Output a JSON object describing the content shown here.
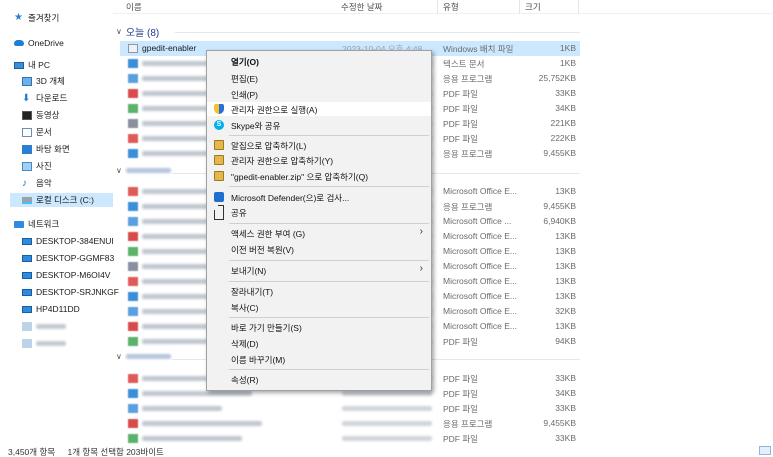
{
  "columns": {
    "name": "이름",
    "date": "수정한 날짜",
    "type": "유형",
    "size": "크기"
  },
  "sidebar": {
    "quick_access": "즐겨찾기",
    "onedrive": "OneDrive",
    "this_pc": "내 PC",
    "items": [
      {
        "label": "3D 개체",
        "icon": "cube-icon"
      },
      {
        "label": "다운로드",
        "icon": "download-icon"
      },
      {
        "label": "동영상",
        "icon": "video-icon"
      },
      {
        "label": "문서",
        "icon": "document-icon"
      },
      {
        "label": "바탕 화면",
        "icon": "desktop-icon"
      },
      {
        "label": "사진",
        "icon": "pictures-icon"
      },
      {
        "label": "음악",
        "icon": "music-icon"
      },
      {
        "label": "로컬 디스크 (C:)",
        "icon": "disk-icon"
      }
    ],
    "network": "네트워크",
    "computers": [
      "DESKTOP-384ENUI",
      "DESKTOP-GGMF83",
      "DESKTOP-M6OI4V",
      "DESKTOP-SRJNKGF",
      "HP4D11DD"
    ]
  },
  "group_today": {
    "label": "오늘 (8)"
  },
  "rows_today": [
    {
      "name": "gpedit-enabler",
      "date": "2023-10-04 오후 4:48",
      "type": "Windows 배치 파일",
      "size": "1KB",
      "selected": true
    },
    {
      "type": "텍스트 문서",
      "size": "1KB"
    },
    {
      "type": "응용 프로그램",
      "size": "25,752KB"
    },
    {
      "type": "PDF 파일",
      "size": "33KB"
    },
    {
      "type": "PDF 파일",
      "size": "34KB"
    },
    {
      "type": "PDF 파일",
      "size": "221KB"
    },
    {
      "type": "PDF 파일",
      "size": "222KB"
    },
    {
      "type": "응용 프로그램",
      "size": "9,455KB"
    }
  ],
  "rows_group2": [
    {
      "type": "Microsoft Office E...",
      "size": "13KB"
    },
    {
      "type": "응용 프로그램",
      "size": "9,455KB"
    },
    {
      "type": "Microsoft Office ...",
      "size": "6,940KB"
    },
    {
      "type": "Microsoft Office E...",
      "size": "13KB"
    },
    {
      "type": "Microsoft Office E...",
      "size": "13KB"
    },
    {
      "type": "Microsoft Office E...",
      "size": "13KB"
    },
    {
      "type": "Microsoft Office E...",
      "size": "13KB"
    },
    {
      "type": "Microsoft Office E...",
      "size": "13KB"
    },
    {
      "type": "Microsoft Office E...",
      "size": "32KB"
    },
    {
      "type": "Microsoft Office E...",
      "size": "13KB"
    },
    {
      "type": "PDF 파일",
      "size": "94KB"
    }
  ],
  "rows_group3": [
    {
      "type": "PDF 파일",
      "size": "33KB"
    },
    {
      "type": "PDF 파일",
      "size": "34KB"
    },
    {
      "type": "PDF 파일",
      "size": "33KB"
    },
    {
      "type": "응용 프로그램",
      "size": "9,455KB"
    },
    {
      "type": "PDF 파일",
      "size": "33KB"
    }
  ],
  "context_menu": {
    "open": "열기(O)",
    "edit": "편집(E)",
    "print": "인쇄(P)",
    "run_as_admin": "관리자 권한으로 실행(A)",
    "skype_share": "Skype와 공유",
    "compress": "알집으로 압축하기(L)",
    "compress_admin": "관리자 권한으로 압축하기(Y)",
    "compress_zip": "\"gpedit-enabler.zip\" 으로 압축하기(Q)",
    "defender_scan": "Microsoft Defender(으)로 검사...",
    "share": "공유",
    "give_access": "액세스 권한 부여 (G)",
    "restore_prev": "이전 버전 복원(V)",
    "send_to": "보내기(N)",
    "cut": "잘라내기(T)",
    "copy": "복사(C)",
    "create_shortcut": "바로 가기 만들기(S)",
    "delete": "삭제(D)",
    "rename": "이름 바꾸기(M)",
    "properties": "속성(R)"
  },
  "status": {
    "item_count": "3,450개 항목",
    "selected": "1개 항목 선택함 203바이트"
  },
  "colors": {
    "selection": "#cce8ff",
    "menu_bg": "#f2f2f2",
    "accent": "#1e7fd6"
  }
}
